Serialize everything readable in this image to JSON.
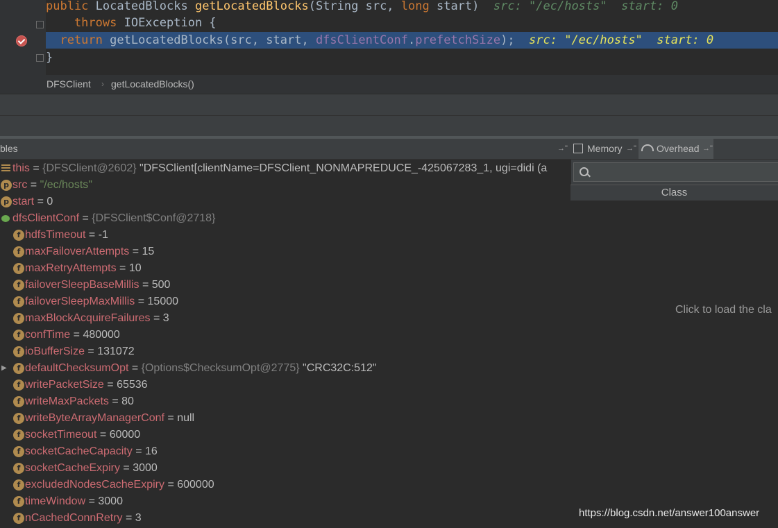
{
  "editor": {
    "lines": [
      {
        "segments": [
          {
            "t": "public ",
            "c": "kw"
          },
          {
            "t": "LocatedBlocks ",
            "c": ""
          },
          {
            "t": "getLocatedBlocks",
            "c": "fn"
          },
          {
            "t": "(String src, ",
            "c": ""
          },
          {
            "t": "long ",
            "c": "kw"
          },
          {
            "t": "start)  ",
            "c": ""
          },
          {
            "t": "src: \"/ec/hosts\"  start: 0",
            "c": "hint"
          }
        ]
      },
      {
        "segments": [
          {
            "t": "    throws ",
            "c": "kw"
          },
          {
            "t": "IOException {",
            "c": ""
          }
        ]
      },
      {
        "segments": [
          {
            "t": "  return ",
            "c": "kw"
          },
          {
            "t": "getLocatedBlocks(src, start, ",
            "c": ""
          },
          {
            "t": "dfsClientConf",
            "c": "fld"
          },
          {
            "t": ".",
            "c": ""
          },
          {
            "t": "prefetchSize",
            "c": "fld"
          },
          {
            "t": ");  ",
            "c": ""
          },
          {
            "t": "src: \"/ec/hosts\"  start: 0",
            "c": "hint-hl"
          }
        ]
      },
      {
        "segments": [
          {
            "t": "}",
            "c": ""
          }
        ]
      }
    ]
  },
  "breadcrumb": {
    "items": [
      "DFSClient",
      "getLocatedBlocks()"
    ],
    "separator": "›"
  },
  "variables": {
    "header_label": "bles",
    "rows": [
      {
        "icon": "lines",
        "name": "this",
        "ref": "{DFSClient@2602}",
        "value": "\"DFSClient[clientName=DFSClient_NONMAPREDUCE_-425067283_1, ugi=didi (a",
        "kind": "plain",
        "indent": 0
      },
      {
        "icon": "p",
        "name": "src",
        "ref": "",
        "value": "\"/ec/hosts\"",
        "kind": "str",
        "indent": 0
      },
      {
        "icon": "p",
        "name": "start",
        "ref": "",
        "value": "0",
        "kind": "plain",
        "indent": 0
      },
      {
        "icon": "watch",
        "name": "dfsClientConf",
        "ref": "{DFSClient$Conf@2718}",
        "value": "",
        "kind": "plain",
        "indent": 0
      },
      {
        "icon": "f",
        "name": "hdfsTimeout",
        "ref": "",
        "value": "-1",
        "kind": "plain",
        "indent": 1
      },
      {
        "icon": "f",
        "name": "maxFailoverAttempts",
        "ref": "",
        "value": "15",
        "kind": "plain",
        "indent": 1
      },
      {
        "icon": "f",
        "name": "maxRetryAttempts",
        "ref": "",
        "value": "10",
        "kind": "plain",
        "indent": 1
      },
      {
        "icon": "f",
        "name": "failoverSleepBaseMillis",
        "ref": "",
        "value": "500",
        "kind": "plain",
        "indent": 1
      },
      {
        "icon": "f",
        "name": "failoverSleepMaxMillis",
        "ref": "",
        "value": "15000",
        "kind": "plain",
        "indent": 1
      },
      {
        "icon": "f",
        "name": "maxBlockAcquireFailures",
        "ref": "",
        "value": "3",
        "kind": "plain",
        "indent": 1
      },
      {
        "icon": "f",
        "name": "confTime",
        "ref": "",
        "value": "480000",
        "kind": "plain",
        "indent": 1
      },
      {
        "icon": "f",
        "name": "ioBufferSize",
        "ref": "",
        "value": "131072",
        "kind": "plain",
        "indent": 1
      },
      {
        "icon": "f",
        "name": "defaultChecksumOpt",
        "ref": "{Options$ChecksumOpt@2775}",
        "value": "\"CRC32C:512\"",
        "kind": "plain",
        "indent": 1,
        "expandable": true
      },
      {
        "icon": "f",
        "name": "writePacketSize",
        "ref": "",
        "value": "65536",
        "kind": "plain",
        "indent": 1
      },
      {
        "icon": "f",
        "name": "writeMaxPackets",
        "ref": "",
        "value": "80",
        "kind": "plain",
        "indent": 1
      },
      {
        "icon": "f",
        "name": "writeByteArrayManagerConf",
        "ref": "",
        "value": "null",
        "kind": "plain",
        "indent": 1
      },
      {
        "icon": "f",
        "name": "socketTimeout",
        "ref": "",
        "value": "60000",
        "kind": "plain",
        "indent": 1
      },
      {
        "icon": "f",
        "name": "socketCacheCapacity",
        "ref": "",
        "value": "16",
        "kind": "plain",
        "indent": 1
      },
      {
        "icon": "f",
        "name": "socketCacheExpiry",
        "ref": "",
        "value": "3000",
        "kind": "plain",
        "indent": 1
      },
      {
        "icon": "f",
        "name": "excludedNodesCacheExpiry",
        "ref": "",
        "value": "600000",
        "kind": "plain",
        "indent": 1
      },
      {
        "icon": "f",
        "name": "timeWindow",
        "ref": "",
        "value": "3000",
        "kind": "plain",
        "indent": 1
      },
      {
        "icon": "f",
        "name": "nCachedConnRetry",
        "ref": "",
        "value": "3",
        "kind": "plain",
        "indent": 1
      }
    ]
  },
  "right_panel": {
    "tabs": [
      {
        "label": "Memory",
        "icon": "memory-icon",
        "active": false
      },
      {
        "label": "Overhead",
        "icon": "gauge-icon",
        "active": true
      }
    ],
    "pin_glyph": "→\"",
    "class_column": "Class",
    "load_hint": "Click to load the cla"
  },
  "watermark": "https://blog.csdn.net/answer100answer",
  "colors": {
    "keyword": "#cc7832",
    "method": "#ffc66d",
    "field": "#9876aa",
    "var_name": "#cc6b72",
    "current_line": "#2d4f7c",
    "inline_hint": "#e6e35a"
  }
}
